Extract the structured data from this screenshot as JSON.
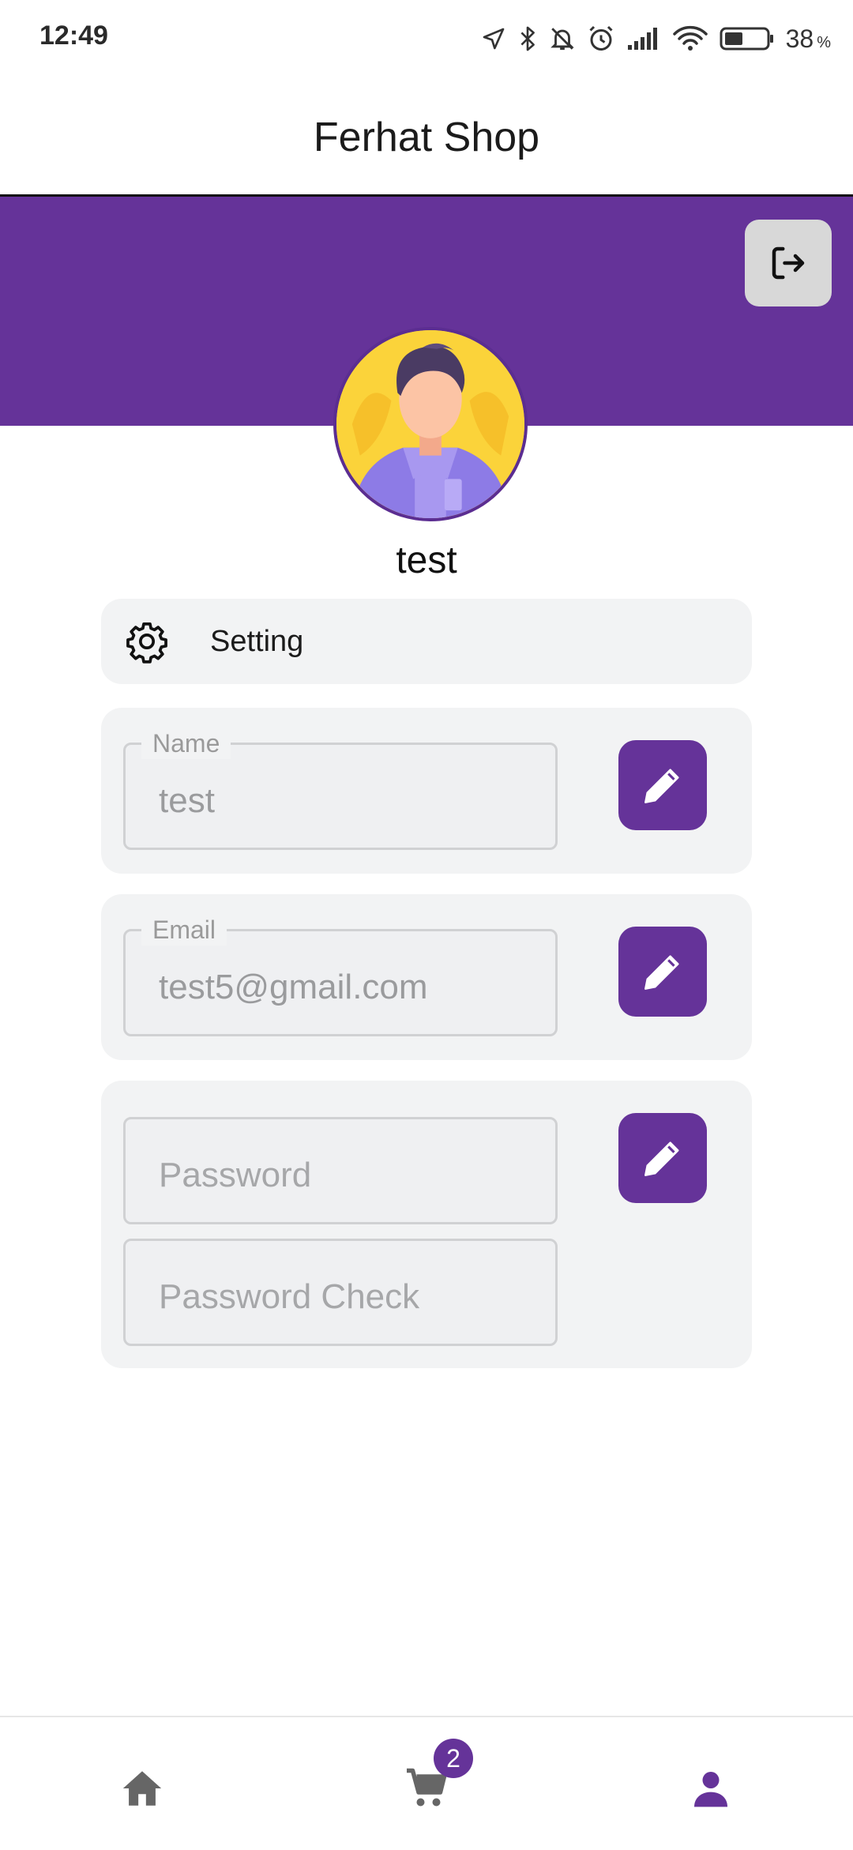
{
  "status_bar": {
    "time": "12:49",
    "battery_percent": "38",
    "battery_unit": "%",
    "icons": [
      "location-arrow-icon",
      "bluetooth-icon",
      "bell-off-icon",
      "alarm-icon",
      "signal-icon",
      "wifi-icon",
      "battery-icon"
    ]
  },
  "app_bar": {
    "title": "Ferhat Shop"
  },
  "header": {
    "logout_icon": "logout-icon",
    "color": "#653399"
  },
  "profile": {
    "username": "test",
    "avatar_icon": "user-avatar"
  },
  "settings": {
    "label": "Setting",
    "icon": "gear-icon"
  },
  "name_field": {
    "label": "Name",
    "value": "test"
  },
  "email_field": {
    "label": "Email",
    "value": "test5@gmail.com"
  },
  "password_fields": {
    "password_placeholder": "Password",
    "password_check_placeholder": "Password Check"
  },
  "edit_icon": "pencil-icon",
  "bottom_nav": {
    "items": [
      "home-icon",
      "cart-icon",
      "profile-icon"
    ],
    "cart_badge": "2",
    "active": "profile"
  },
  "colors": {
    "accent": "#653399",
    "card_bg": "#f2f3f4",
    "logout_bg": "#d8d8d8"
  }
}
